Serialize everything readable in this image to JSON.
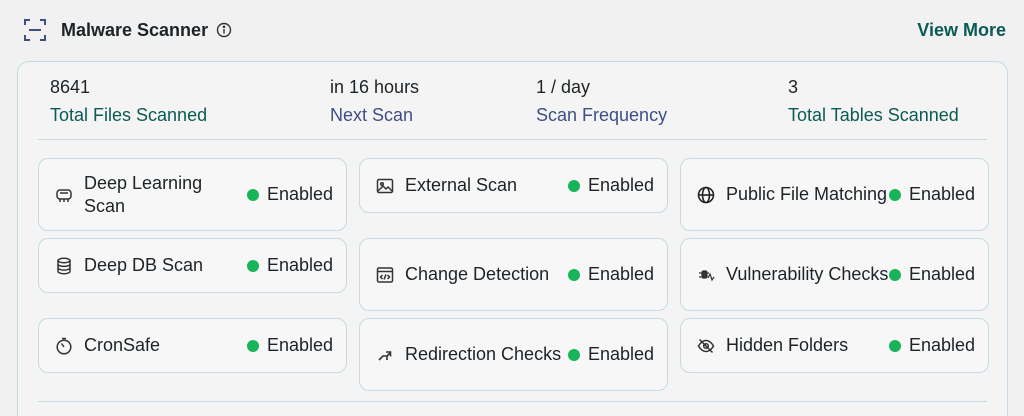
{
  "header": {
    "title": "Malware Scanner",
    "view_more": "View More"
  },
  "stats": [
    {
      "value": "8641",
      "label": "Total Files Scanned"
    },
    {
      "value": "in 16 hours",
      "label": "Next Scan"
    },
    {
      "value": "1 / day",
      "label": "Scan Frequency"
    },
    {
      "value": "3",
      "label": "Total Tables Scanned"
    }
  ],
  "features": [
    {
      "label": "Deep Learning Scan",
      "status": "Enabled",
      "icon": "chip-icon"
    },
    {
      "label": "External Scan",
      "status": "Enabled",
      "icon": "image-icon"
    },
    {
      "label": "Public File Matching",
      "status": "Enabled",
      "icon": "globe-icon"
    },
    {
      "label": "Deep DB Scan",
      "status": "Enabled",
      "icon": "database-icon"
    },
    {
      "label": "Change Detection",
      "status": "Enabled",
      "icon": "code-window-icon"
    },
    {
      "label": "Vulnerability Checks",
      "status": "Enabled",
      "icon": "bug-icon"
    },
    {
      "label": "CronSafe",
      "status": "Enabled",
      "icon": "timer-icon"
    },
    {
      "label": "Redirection Checks",
      "status": "Enabled",
      "icon": "redirect-arrow-icon"
    },
    {
      "label": "Hidden Folders",
      "status": "Enabled",
      "icon": "eye-off-icon"
    }
  ],
  "colors": {
    "accent_teal": "#0b5a55",
    "label_purple": "#3f4e86",
    "status_green": "#19b45a",
    "border": "#c4dbe6"
  }
}
